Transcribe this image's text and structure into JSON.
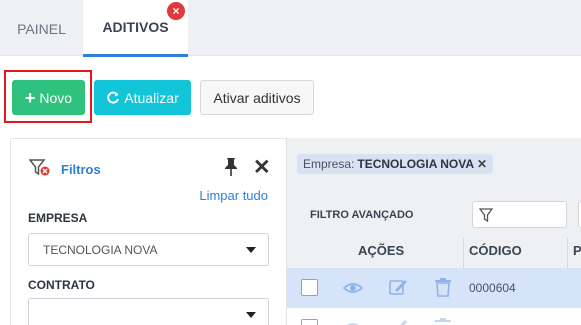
{
  "tabs": [
    {
      "label": "PAINEL"
    },
    {
      "label": "ADITIVOS",
      "close": "×"
    }
  ],
  "toolbar": {
    "novo_label": "Novo",
    "atualizar_label": "Atualizar",
    "ativar_label": "Ativar aditivos"
  },
  "filters": {
    "title": "Filtros",
    "clear_label": "Limpar tudo",
    "empresa_label": "EMPRESA",
    "empresa_value": "TECNOLOGIA NOVA",
    "contrato_label": "CONTRATO",
    "close": "✕"
  },
  "grid": {
    "chip_prefix": "Empresa:",
    "chip_value": "TECNOLOGIA NOVA",
    "chip_close": "✕",
    "advanced_filter_label": "FILTRO AVANÇADO",
    "columns": [
      "AÇÕES",
      "CÓDIGO",
      "P"
    ],
    "rows": [
      {
        "code": "0000604"
      }
    ]
  },
  "colors": {
    "accent": "#2f7fd8",
    "novo": "#2ec27e",
    "atualizar": "#13c5d8",
    "close_badge": "#e03a3a",
    "highlight": "#e0191b"
  },
  "icons": [
    "filter-icon",
    "pin-icon",
    "close-icon",
    "refresh-icon",
    "plus-icon",
    "eye-icon",
    "edit-icon",
    "trash-icon",
    "chevron-down-icon"
  ]
}
